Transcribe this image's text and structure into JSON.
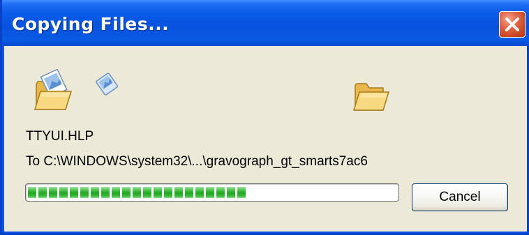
{
  "window": {
    "title": "Copying Files..."
  },
  "title_bar": {
    "close_icon": "close-icon"
  },
  "animation": {
    "source_icon": "open-folder-icon",
    "flying_icon": "flying-document-icon",
    "destination_icon": "open-folder-icon"
  },
  "status": {
    "filename": "TTYUI.HLP",
    "destination": "To C:\\WINDOWS\\system32\\...\\gravograph_gt_smarts7ac6"
  },
  "progress": {
    "percent": 61,
    "fill_color": "#22a822"
  },
  "buttons": {
    "cancel_label": "Cancel"
  },
  "colors": {
    "title_bar": "#0a5ae8",
    "dialog_background": "#ece9d8",
    "close_button": "#c9441f"
  }
}
